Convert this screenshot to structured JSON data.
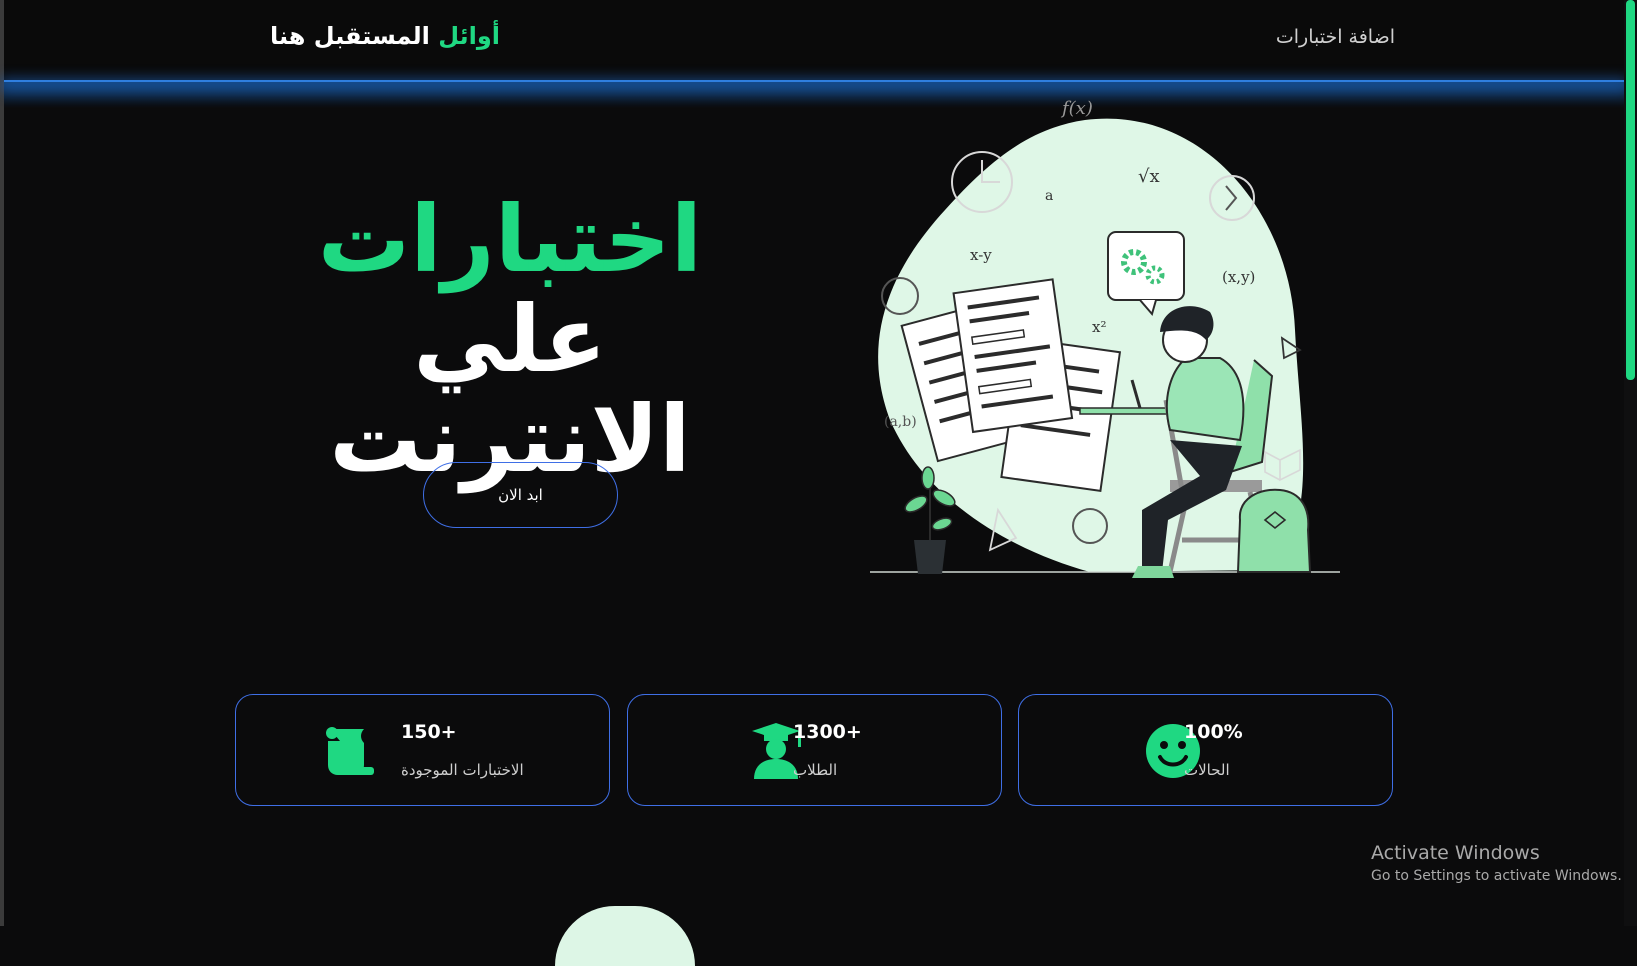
{
  "header": {
    "brand_accent": "أوائل",
    "brand_rest": "المستقبل هنا",
    "nav_link": "اضافة اختبارات"
  },
  "hero": {
    "title_accent": "اختبارات",
    "title_word2": "علي",
    "title_line2": "الانترنت",
    "cta_label": "ابد الان"
  },
  "stats": [
    {
      "value": "150+",
      "label": "الاختبارات الموجودة",
      "icon": "scroll-icon"
    },
    {
      "value": "1300+",
      "label": "الطلاب",
      "icon": "graduate-icon"
    },
    {
      "value": "100%",
      "label": "الحالات",
      "icon": "smiley-icon"
    }
  ],
  "watermark": {
    "title": "Activate Windows",
    "subtitle": "Go to Settings to activate Windows."
  },
  "colors": {
    "accent": "#1fd882",
    "card_border": "#3f6fe6",
    "background": "#0b0b0c",
    "header_line": "#2f7fe0"
  }
}
